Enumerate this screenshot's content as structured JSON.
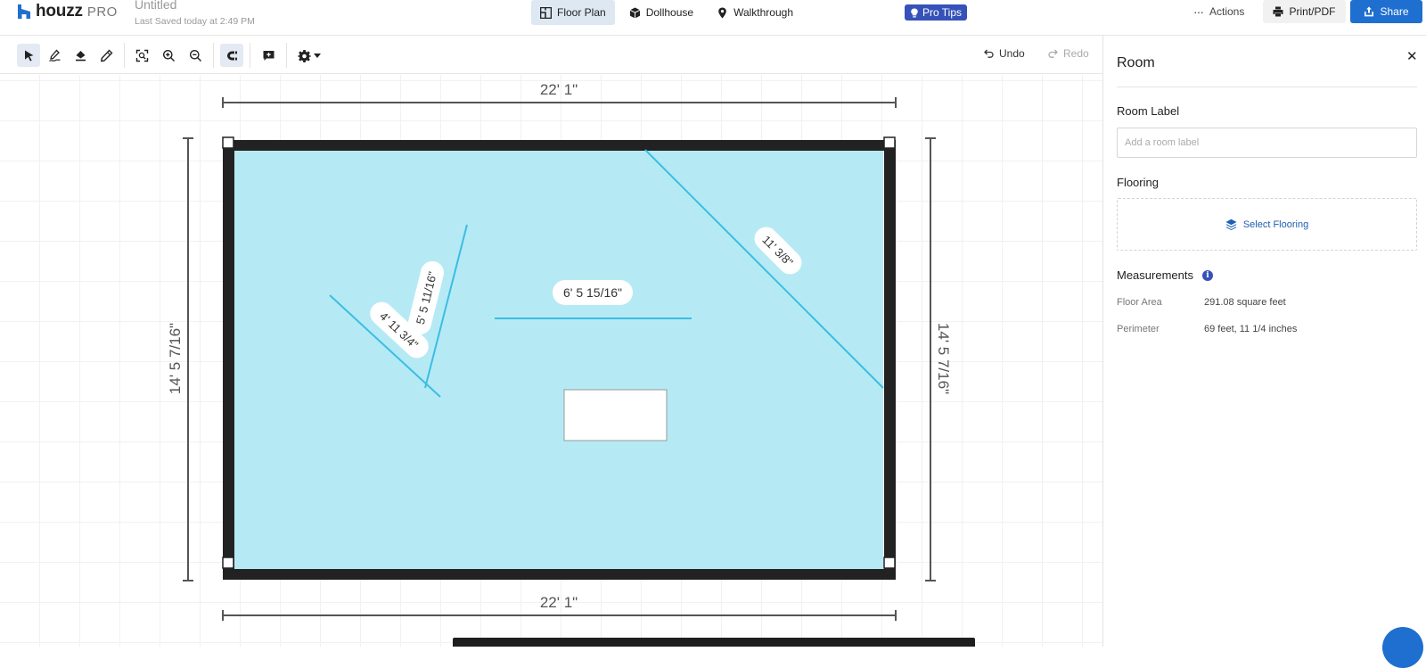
{
  "app": {
    "logo_text": "houzz",
    "logo_suffix": "PRO",
    "doc_title": "Untitled",
    "doc_saved": "Last Saved today at 2:49 PM"
  },
  "view_tabs": [
    {
      "label": "Floor Plan",
      "icon": "floorplan-icon",
      "active": true
    },
    {
      "label": "Dollhouse",
      "icon": "cube-icon",
      "active": false
    },
    {
      "label": "Walkthrough",
      "icon": "location-pin-icon",
      "active": false
    }
  ],
  "header": {
    "pro_tips": "Pro Tips",
    "actions": "Actions",
    "print": "Print/PDF",
    "share": "Share"
  },
  "toolbar": {
    "tools": [
      "select-pointer-icon",
      "draw-wall-icon",
      "fill-room-icon",
      "pencil-icon",
      "fit-view-icon",
      "zoom-in-icon",
      "zoom-out-icon",
      "magnet-snap-icon",
      "add-comment-icon",
      "settings-gear-icon"
    ],
    "active_tools": [
      "select-pointer-icon",
      "magnet-snap-icon"
    ],
    "undo": "Undo",
    "redo": "Redo"
  },
  "plan": {
    "room_fill": "#b5eaf4",
    "wall_color": "#222222",
    "measure_line_color": "#3bbde3",
    "dim_top": "22' 1\"",
    "dim_bottom": "22' 1\"",
    "dim_left": "14' 5 7/16\"",
    "dim_right": "14' 5 7/16\"",
    "measure_labels": {
      "horizontal": "6' 5 15/16\"",
      "diagonal_right": "11' 3/8\"",
      "diagonal_left_a": "5' 5 11/16\"",
      "diagonal_left_b": "4' 11 3/4\""
    }
  },
  "panel": {
    "title": "Room",
    "room_label_heading": "Room Label",
    "room_label_placeholder": "Add a room label",
    "room_label_value": "",
    "flooring_heading": "Flooring",
    "select_flooring": "Select Flooring",
    "measurements_heading": "Measurements",
    "measurements": [
      {
        "key": "Floor Area",
        "value": "291.08 square feet"
      },
      {
        "key": "Perimeter",
        "value": "69 feet, 11 1/4 inches"
      }
    ]
  },
  "colors": {
    "accent_blue": "#1f6fd0",
    "pro_tips_bg": "#3652b8",
    "active_tab_bg": "#dde8f3"
  }
}
